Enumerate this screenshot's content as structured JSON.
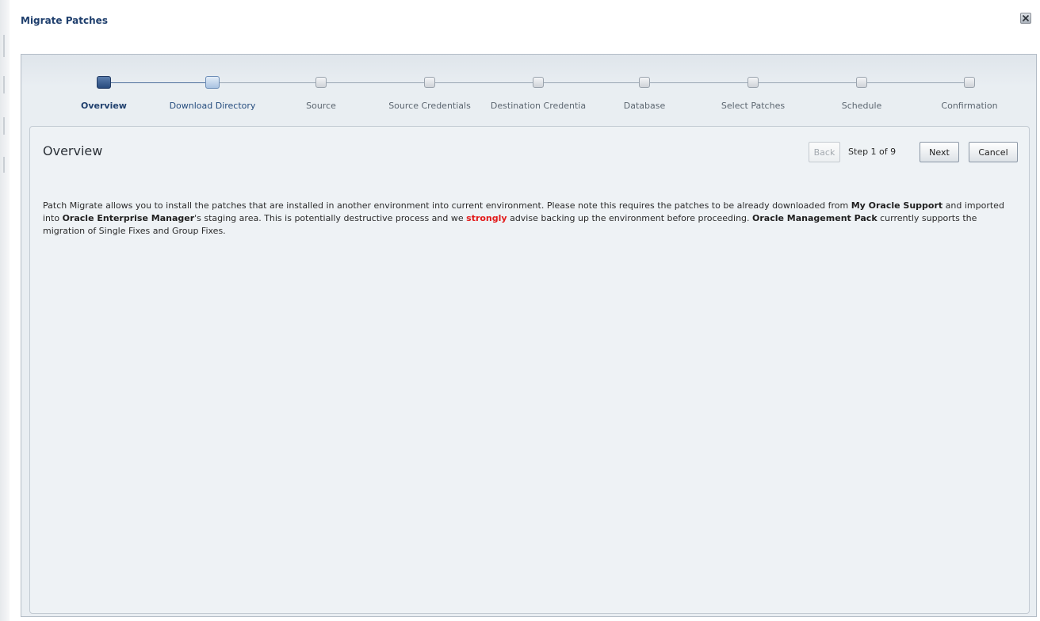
{
  "dialog": {
    "title": "Migrate Patches",
    "close_icon": "close-icon"
  },
  "train": {
    "steps": [
      {
        "label": "Overview",
        "state": "current"
      },
      {
        "label": "Download Directory",
        "state": "next"
      },
      {
        "label": "Source",
        "state": "disabled"
      },
      {
        "label": "Source Credentials",
        "state": "disabled"
      },
      {
        "label": "Destination Credentia",
        "state": "disabled"
      },
      {
        "label": "Database",
        "state": "disabled"
      },
      {
        "label": "Select Patches",
        "state": "disabled"
      },
      {
        "label": "Schedule",
        "state": "disabled"
      },
      {
        "label": "Confirmation",
        "state": "disabled"
      }
    ]
  },
  "panel": {
    "title": "Overview",
    "back_label": "Back",
    "step_text": "Step 1 of 9",
    "next_label": "Next",
    "cancel_label": "Cancel",
    "desc": {
      "p1": "Patch Migrate allows you to install the patches that are installed in another environment into current environment.  Please note this requires the patches to be already downloaded from ",
      "b1": "My Oracle Support",
      "p2": " and imported into ",
      "b2": "Oracle Enterprise Manager",
      "p3": "'s staging area.  This is potentially destructive process and we ",
      "emph": "strongly",
      "p4": " advise backing up the environment before proceeding. ",
      "b3": "Oracle Management Pack",
      "p5": " currently supports the migration of Single Fixes and Group Fixes."
    }
  },
  "colors": {
    "accent": "#1f3f6d",
    "warning": "#e21a1a",
    "panel_bg": "#eef2f5"
  }
}
